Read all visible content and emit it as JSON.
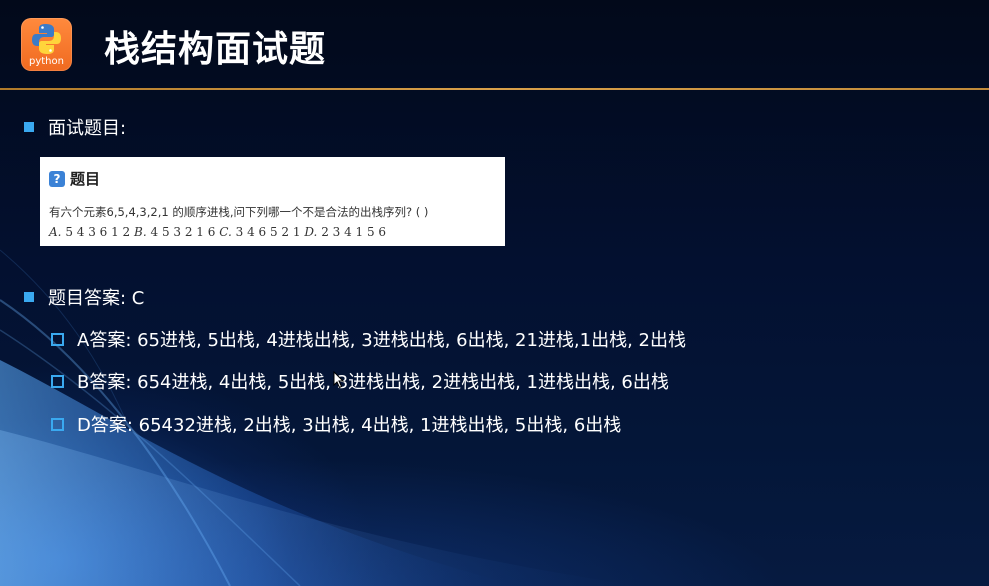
{
  "header": {
    "logo_text": "python",
    "title": "栈结构面试题"
  },
  "section1": {
    "label": "面试题目:"
  },
  "question": {
    "head_icon": "?",
    "head_label": "题目",
    "text": "有六个元素6,5,4,3,2,1  的顺序进栈,问下列哪一个不是合法的出栈序列? (    )",
    "options": [
      {
        "letter": "A.",
        "value": "5 4 3 6 1 2"
      },
      {
        "letter": "B.",
        "value": "4 5 3 2 1 6"
      },
      {
        "letter": "C.",
        "value": "3 4 6 5 2 1"
      },
      {
        "letter": "D.",
        "value": "2 3 4 1 5 6"
      }
    ]
  },
  "section2": {
    "label": "题目答案: C"
  },
  "answers": [
    "A答案: 65进栈, 5出栈, 4进栈出栈, 3进栈出栈, 6出栈, 21进栈,1出栈, 2出栈",
    "B答案: 654进栈, 4出栈, 5出栈, 3进栈出栈, 2进栈出栈, 1进栈出栈, 6出栈",
    "D答案: 65432进栈, 2出栈, 3出栈, 4出栈, 1进栈出栈, 5出栈, 6出栈"
  ],
  "colors": {
    "accent": "#3aa9f0",
    "divider": "#d9a04a",
    "logo": "#f06a20"
  }
}
